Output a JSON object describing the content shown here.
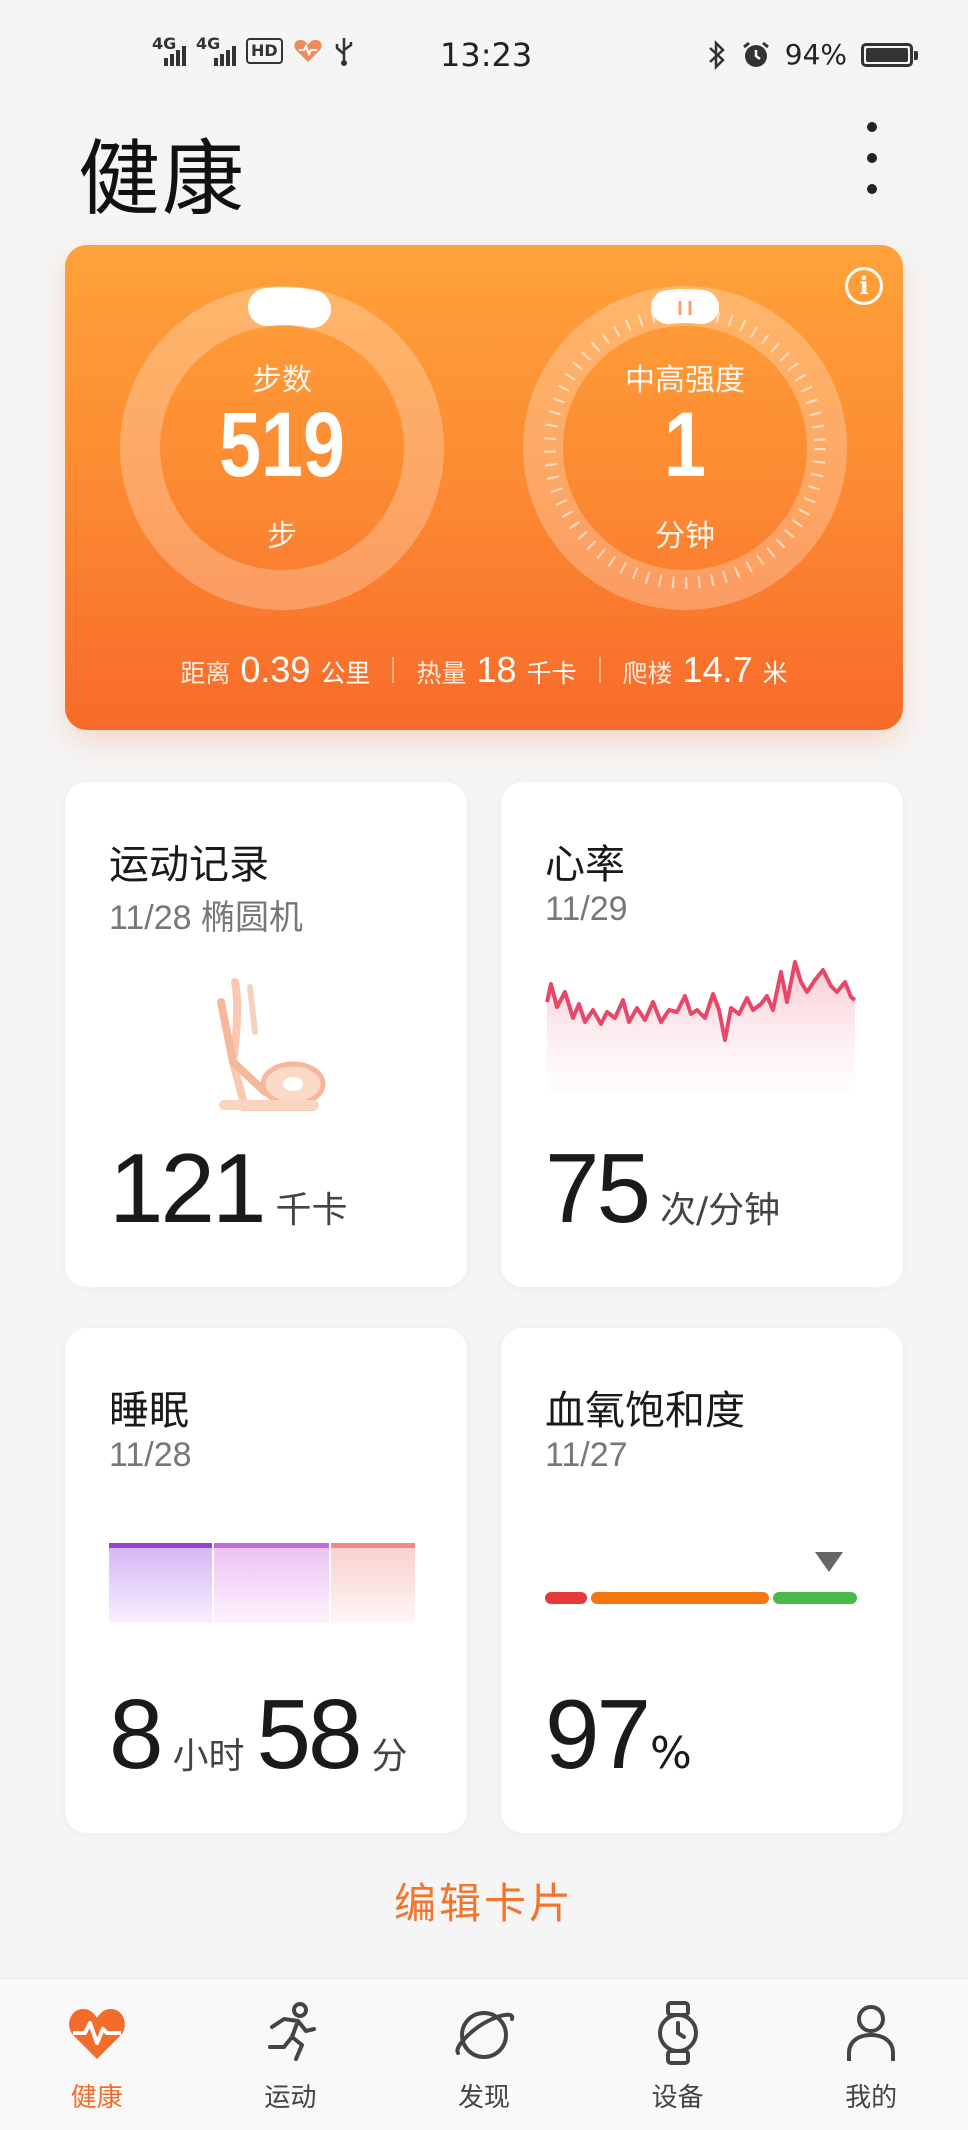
{
  "status_bar": {
    "network1": "4G",
    "network2": "4G",
    "hd": "HD",
    "time": "13:23",
    "battery": "94%"
  },
  "page": {
    "title": "健康"
  },
  "activity": {
    "steps_label": "步数",
    "steps_value": "519",
    "steps_unit": "步",
    "intensity_label": "中高强度",
    "intensity_value": "1",
    "intensity_unit": "分钟",
    "distance_label": "距离",
    "distance_value": "0.39",
    "distance_unit": "公里",
    "calories_label": "热量",
    "calories_value": "18",
    "calories_unit": "千卡",
    "floors_label": "爬楼",
    "floors_value": "14.7",
    "floors_unit": "米",
    "colors": {
      "top": "#ffa23a",
      "bottom": "#f86a2a"
    }
  },
  "cards": {
    "workout": {
      "title": "运动记录",
      "date": "11/28 椭圆机",
      "value": "121",
      "unit": "千卡",
      "icon": "elliptical-icon"
    },
    "heart": {
      "title": "心率",
      "date": "11/29",
      "value": "75",
      "unit": "次/分钟",
      "line_color": "#e8476a"
    },
    "sleep": {
      "title": "睡眠",
      "date": "11/28",
      "hours": "8",
      "hours_unit": "小时",
      "minutes": "58",
      "minutes_unit": "分",
      "stage_colors": [
        "#9b3fd0",
        "#c56ad8",
        "#ee8a8a"
      ]
    },
    "spo2": {
      "title": "血氧饱和度",
      "date": "11/27",
      "value": "97",
      "unit": "%",
      "scale_colors": [
        "#e53a3a",
        "#f5760f",
        "#4ab94a"
      ]
    }
  },
  "edit_label": "编辑卡片",
  "nav": [
    {
      "label": "健康",
      "icon": "heart-icon",
      "active": true
    },
    {
      "label": "运动",
      "icon": "running-icon"
    },
    {
      "label": "发现",
      "icon": "planet-icon"
    },
    {
      "label": "设备",
      "icon": "watch-icon"
    },
    {
      "label": "我的",
      "icon": "person-icon"
    }
  ],
  "accent": "#f36c2c"
}
